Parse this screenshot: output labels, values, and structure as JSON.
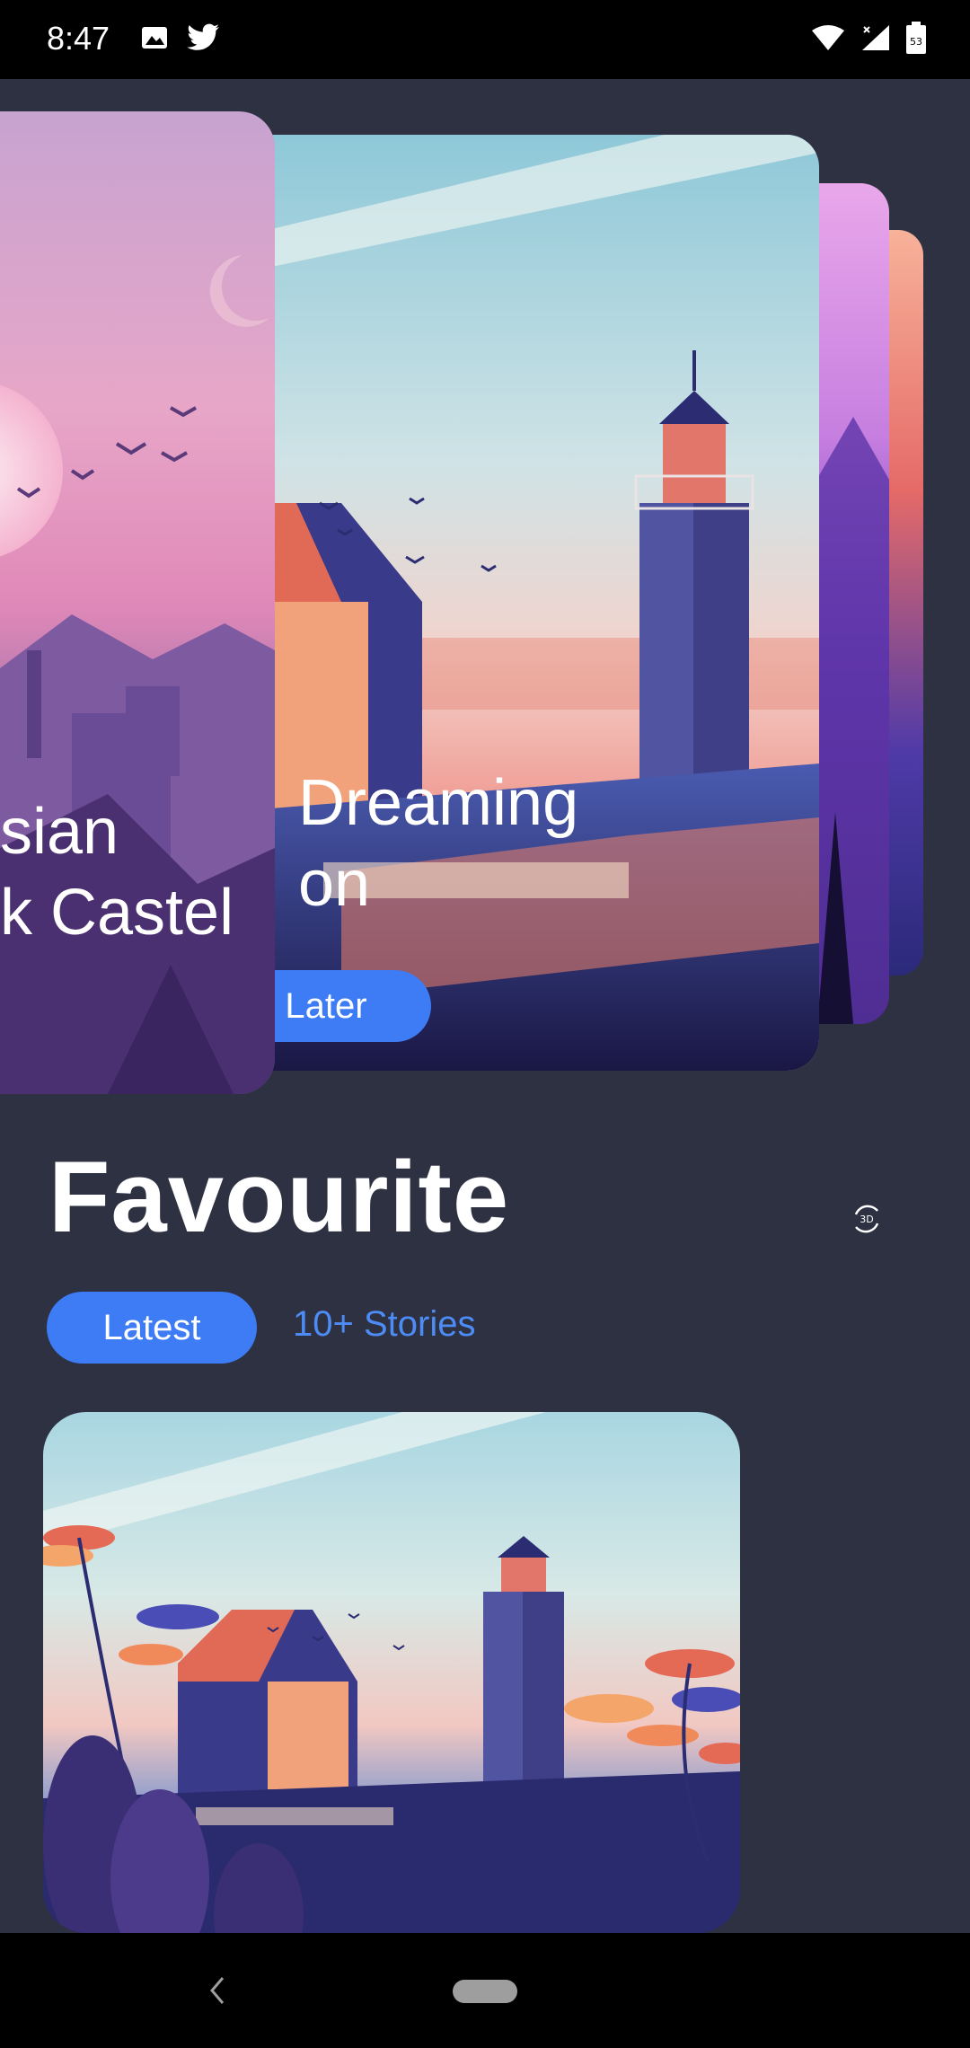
{
  "status_bar": {
    "time": "8:47",
    "left_icons": [
      "image-icon",
      "twitter-icon"
    ],
    "right_icons": [
      "wifi-icon",
      "signal-icon",
      "battery-icon"
    ],
    "battery_level": "53"
  },
  "carousel": {
    "cards": [
      {
        "title_line1": "sian",
        "title_line2": "k Castel"
      },
      {
        "title_line1": "Dreaming",
        "title_line2": "on",
        "button_label": "d Later"
      }
    ]
  },
  "favourite": {
    "title": "Favourite",
    "view_mode_label": "3D",
    "chips": {
      "latest": "Latest",
      "stories": "10+ Stories"
    }
  },
  "colors": {
    "background": "#2d3142",
    "accent": "#3d7cf5",
    "link": "#4d8cf5"
  }
}
